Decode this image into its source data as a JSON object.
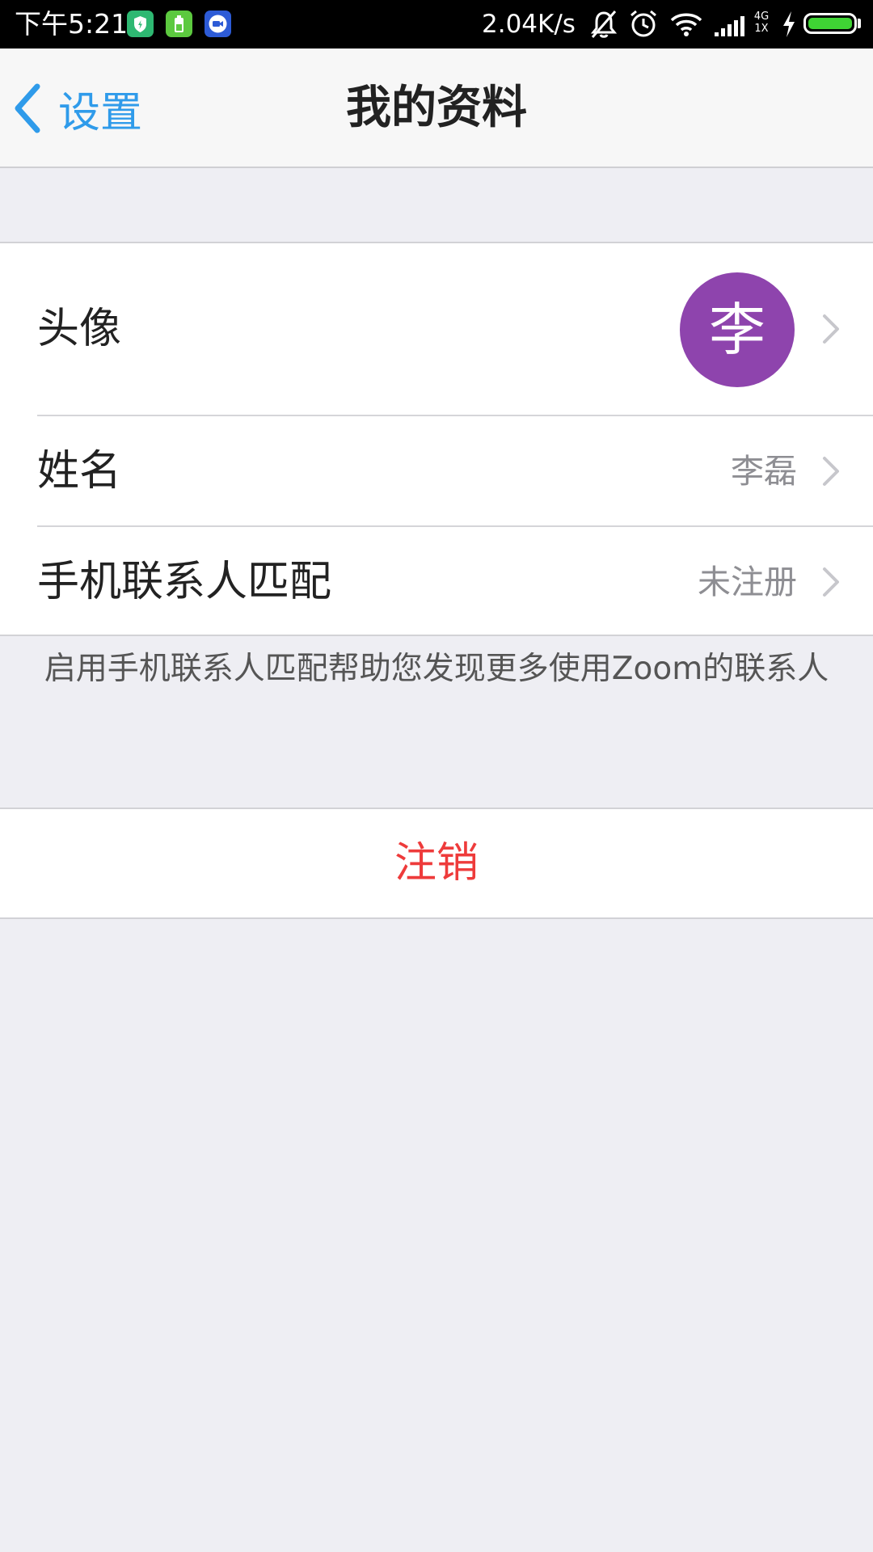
{
  "status_bar": {
    "time": "下午5:21",
    "app_icons": [
      {
        "name": "shield-app-icon",
        "color": "#2EB872"
      },
      {
        "name": "battery-app-icon",
        "color": "#5CC93F"
      },
      {
        "name": "zoom-app-icon",
        "color": "#2D5BD6"
      }
    ],
    "net_speed": "2.04K/s",
    "icons": [
      "bell-muted-icon",
      "alarm-icon",
      "wifi-icon",
      "signal-icon",
      "charging-icon"
    ],
    "network_top": "4G",
    "network_bottom": "1X",
    "battery_level": 1.0,
    "battery_color": "#3FD434"
  },
  "nav": {
    "back_label": "设置",
    "title": "我的资料",
    "accent_color": "#2F9BEA"
  },
  "profile": {
    "avatar_row": {
      "label": "头像",
      "avatar_text": "李",
      "avatar_color": "#8E44AD"
    },
    "name_row": {
      "label": "姓名",
      "value": "李磊"
    },
    "contacts_row": {
      "label": "手机联系人匹配",
      "value": "未注册"
    }
  },
  "hint": "启用手机联系人匹配帮助您发现更多使用Zoom的联系人",
  "logout": {
    "label": "注销",
    "color": "#EE3B3B"
  }
}
